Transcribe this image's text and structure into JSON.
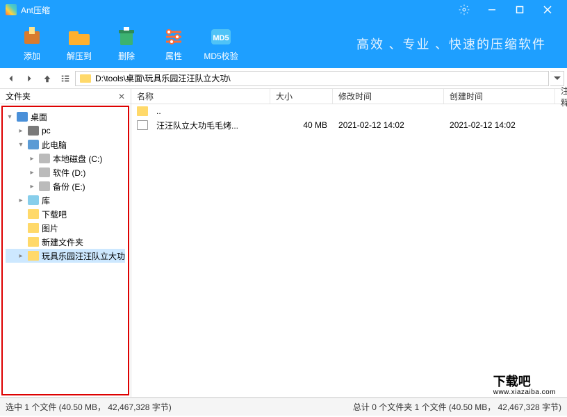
{
  "app": {
    "title": "Ant压缩"
  },
  "sysbuttons": {
    "settings": "settings",
    "min": "min",
    "max": "max",
    "close": "close"
  },
  "toolbar": {
    "add": "添加",
    "extract": "解压到",
    "delete": "删除",
    "props": "属性",
    "md5": "MD5校验",
    "slogan": "高效 、专业 、快速的压缩软件"
  },
  "path": "D:\\tools\\桌面\\玩具乐园汪汪队立大功\\",
  "sidebar": {
    "title": "文件夹",
    "items": [
      {
        "label": "桌面",
        "indent": 0,
        "icon": "ico-desktop",
        "exp": "▾"
      },
      {
        "label": "pc",
        "indent": 1,
        "icon": "ico-pc",
        "exp": "▸"
      },
      {
        "label": "此电脑",
        "indent": 1,
        "icon": "ico-thispc",
        "exp": "▾"
      },
      {
        "label": "本地磁盘 (C:)",
        "indent": 2,
        "icon": "ico-disk",
        "exp": "▸"
      },
      {
        "label": "软件 (D:)",
        "indent": 2,
        "icon": "ico-disk",
        "exp": "▸"
      },
      {
        "label": "备份 (E:)",
        "indent": 2,
        "icon": "ico-disk",
        "exp": "▸"
      },
      {
        "label": "库",
        "indent": 1,
        "icon": "ico-lib",
        "exp": "▸"
      },
      {
        "label": "下载吧",
        "indent": 1,
        "icon": "ico-folder",
        "exp": ""
      },
      {
        "label": "图片",
        "indent": 1,
        "icon": "ico-folder",
        "exp": ""
      },
      {
        "label": "新建文件夹",
        "indent": 1,
        "icon": "ico-folder",
        "exp": ""
      },
      {
        "label": "玩具乐园汪汪队立大功",
        "indent": 1,
        "icon": "ico-folder",
        "exp": "▸",
        "selected": true
      }
    ]
  },
  "columns": {
    "name": "名称",
    "size": "大小",
    "mod": "修改时间",
    "create": "创建时间",
    "note": "注释"
  },
  "files": [
    {
      "name": "..",
      "icon": "ico-folder",
      "size": "",
      "mod": "",
      "create": ""
    },
    {
      "name": "汪汪队立大功毛毛烤...",
      "icon": "ico-file",
      "size": "40 MB",
      "mod": "2021-02-12 14:02",
      "create": "2021-02-12 14:02"
    }
  ],
  "status": {
    "left": "选中 1 个文件 (40.50 MB， 42,467,328 字节)",
    "right": "总计 0 个文件夹 1 个文件 (40.50 MB， 42,467,328 字节)"
  },
  "watermark": {
    "main": "下载吧",
    "sub": "www.xiazaiba.com"
  }
}
